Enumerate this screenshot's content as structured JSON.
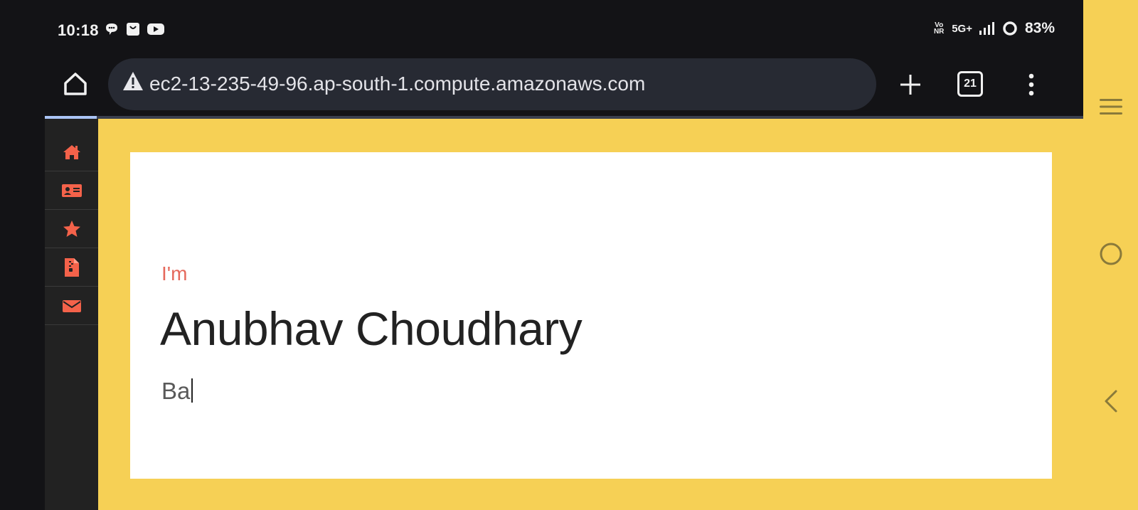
{
  "status_bar": {
    "time": "10:18",
    "app_icons": [
      "chat-bubble-icon",
      "shopping-bag-icon",
      "youtube-icon"
    ],
    "volte": "Vo NR",
    "network": "5G+",
    "battery_percent": "83%"
  },
  "browser": {
    "url": "ec2-13-235-49-96.ap-south-1.compute.amazonaws.com",
    "security": "not-secure-warning",
    "tab_count": "21",
    "load_progress": 0.05
  },
  "sidebar": {
    "items": [
      {
        "icon": "home-icon",
        "color": "#f4624a"
      },
      {
        "icon": "id-card-icon",
        "color": "#f4624a"
      },
      {
        "icon": "star-icon",
        "color": "#f4624a"
      },
      {
        "icon": "zip-file-icon",
        "color": "#f4624a"
      },
      {
        "icon": "envelope-icon",
        "color": "#f4624a"
      }
    ]
  },
  "hero": {
    "intro": "I'm",
    "name": "Anubhav Choudhary",
    "typed_text": "Ba"
  },
  "colors": {
    "page_background": "#f6d055",
    "sidebar_background": "#222222",
    "accent": "#e5695c"
  }
}
